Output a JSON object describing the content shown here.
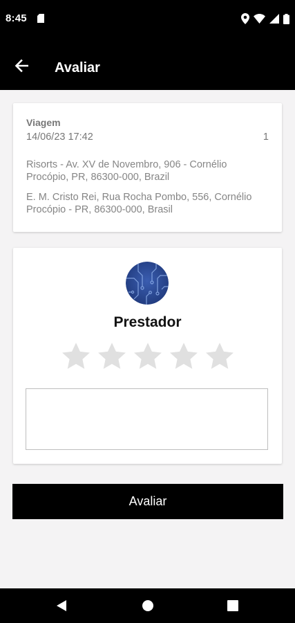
{
  "status_bar": {
    "time": "8:45",
    "icons": [
      "sd-card-icon",
      "location-icon",
      "wifi-icon",
      "signal-icon",
      "battery-icon"
    ]
  },
  "app_bar": {
    "title": "Avaliar",
    "back_icon": "arrow-left-icon"
  },
  "trip": {
    "label": "Viagem",
    "datetime": "14/06/23 17:42",
    "count": "1",
    "origin": "Risorts - Av. XV de Novembro, 906 - Cornélio Procópio, PR, 86300-000, Brazil",
    "destination": "E. M. Cristo Rei, Rua Rocha Pombo, 556, Cornélio Procópio - PR, 86300-000, Brasil"
  },
  "rating": {
    "provider_label": "Prestador",
    "stars_total": 5,
    "stars_selected": 0,
    "comment_value": "",
    "star_color_empty": "#e0e0e0",
    "avatar_color": "#2f4e9a"
  },
  "actions": {
    "submit_label": "Avaliar"
  },
  "nav_bar": {
    "icons": [
      "back-triangle-icon",
      "home-circle-icon",
      "recents-square-icon"
    ]
  },
  "colors": {
    "bar_background": "#000000",
    "page_background": "#f4f3f4",
    "card_background": "#ffffff",
    "secondary_text": "#777777"
  }
}
